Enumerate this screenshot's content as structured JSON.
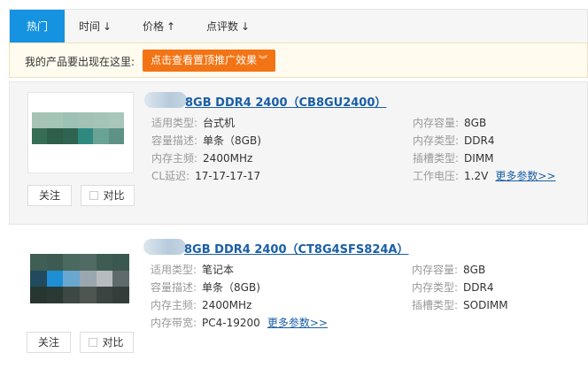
{
  "tabs": [
    {
      "label": "热门",
      "arrow": ""
    },
    {
      "label": "时间",
      "arrow": "↓"
    },
    {
      "label": "价格",
      "arrow": "↑"
    },
    {
      "label": "点评数",
      "arrow": "↓"
    }
  ],
  "promo": {
    "text": "我的产品要出现在这里:",
    "button_label": "点击查看置顶推广效果",
    "button_icon": "double-chevron-down-icon"
  },
  "colors": {
    "accent_blue": "#1592e0",
    "promo_orange": "#f37415",
    "link_blue": "#1a5fa6"
  },
  "products": [
    {
      "title": "8GB DDR4 2400（CB8GU2400）",
      "follow_label": "关注",
      "compare_label": "对比",
      "thumbnail_colors": [
        "#a7c3b5",
        "#a4c4b6",
        "#9ec1b5",
        "#a1c2b5",
        "#a5c4b7",
        "#a8c6b9",
        "#356e55",
        "#2d5f49",
        "#2f6450",
        "#2e8a80",
        "#6aa396",
        "#5e9286"
      ],
      "left_specs": [
        {
          "label": "适用类型:",
          "value": "台式机"
        },
        {
          "label": "容量描述:",
          "value": "单条（8GB)"
        },
        {
          "label": "内存主频:",
          "value": "2400MHz"
        },
        {
          "label": "CL延迟:",
          "value": "17-17-17-17"
        }
      ],
      "right_specs": [
        {
          "label": "内存容量:",
          "value": "8GB"
        },
        {
          "label": "内存类型:",
          "value": "DDR4"
        },
        {
          "label": "插槽类型:",
          "value": "DIMM"
        },
        {
          "label": "工作电压:",
          "value": "1.2V"
        }
      ],
      "more_label": "更多参数>>"
    },
    {
      "title": "8GB DDR4 2400（CT8G4SFS824A）",
      "follow_label": "关注",
      "compare_label": "对比",
      "thumbnail_colors": [
        "#3f5e54",
        "#3d5b52",
        "#4a6a60",
        "#4f6b63",
        "#3f5c53",
        "#3b5850",
        "#214a5e",
        "#1e8fd4",
        "#6aa7cf",
        "#9aa7b0",
        "#b7bcc0",
        "#5f6a6c",
        "#283631",
        "#2b3934",
        "#3c4844",
        "#4e5652",
        "#3a4440",
        "#333d3a"
      ],
      "left_specs": [
        {
          "label": "适用类型:",
          "value": "笔记本"
        },
        {
          "label": "容量描述:",
          "value": "单条（8GB)"
        },
        {
          "label": "内存主频:",
          "value": "2400MHz"
        },
        {
          "label": "内存带宽:",
          "value": "PC4-19200"
        }
      ],
      "right_specs": [
        {
          "label": "内存容量:",
          "value": "8GB"
        },
        {
          "label": "内存类型:",
          "value": "DDR4"
        },
        {
          "label": "插槽类型:",
          "value": "SODIMM"
        }
      ],
      "more_label": "更多参数>>"
    }
  ]
}
